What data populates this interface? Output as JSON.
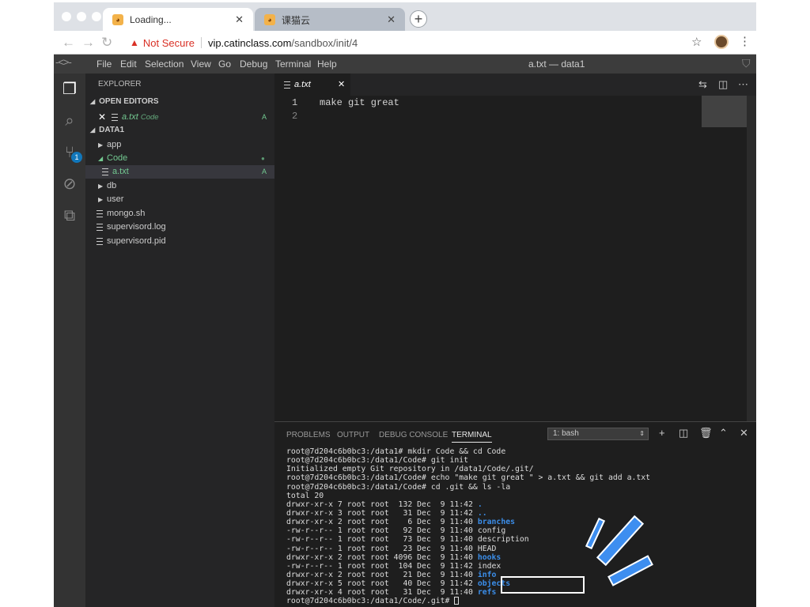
{
  "browser": {
    "tabs": [
      {
        "title": "Loading...",
        "close": "✕"
      },
      {
        "title": "课猫云",
        "close": "✕"
      }
    ],
    "new_tab": "+",
    "security_warning": "Not Secure",
    "url_domain": "vip.catinclass.com",
    "url_path": "/sandbox/init/4"
  },
  "menu": {
    "items": [
      "File",
      "Edit",
      "Selection",
      "View",
      "Go",
      "Debug",
      "Terminal",
      "Help"
    ],
    "window_title": "a.txt — data1"
  },
  "activity_bar": {
    "icons": [
      "explorer-icon",
      "search-icon",
      "source-control-icon",
      "debug-icon",
      "extensions-icon"
    ],
    "scm_badge": "1"
  },
  "sidebar": {
    "title": "EXPLORER",
    "open_editors_label": "OPEN EDITORS",
    "open_editor": {
      "name": "a.txt",
      "folder": "Code",
      "status": "A"
    },
    "workspace_label": "DATA1",
    "tree": [
      {
        "name": "app",
        "kind": "folder"
      },
      {
        "name": "Code",
        "kind": "folder-open"
      },
      {
        "name": "a.txt",
        "kind": "file",
        "status": "A"
      },
      {
        "name": "db",
        "kind": "folder"
      },
      {
        "name": "user",
        "kind": "folder"
      },
      {
        "name": "mongo.sh",
        "kind": "file"
      },
      {
        "name": "supervisord.log",
        "kind": "file"
      },
      {
        "name": "supervisord.pid",
        "kind": "file"
      }
    ]
  },
  "editor": {
    "tab": "a.txt",
    "tab_close": "✕",
    "lines": [
      {
        "num": "1",
        "text": "make git great"
      },
      {
        "num": "2",
        "text": ""
      }
    ]
  },
  "panel": {
    "tabs": [
      "PROBLEMS",
      "OUTPUT",
      "DEBUG CONSOLE",
      "TERMINAL"
    ],
    "active_tab": "TERMINAL",
    "terminal_select": "1: bash",
    "terminal_lines": [
      {
        "text": "root@7d204c6b0bc3:/data1# mkdir Code && cd Code"
      },
      {
        "text": "root@7d204c6b0bc3:/data1/Code# git init"
      },
      {
        "text": "Initialized empty Git repository in /data1/Code/.git/"
      },
      {
        "text": "root@7d204c6b0bc3:/data1/Code# echo \"make git great \" > a.txt && git add a.txt"
      },
      {
        "text": "root@7d204c6b0bc3:/data1/Code# cd .git && ls -la"
      },
      {
        "text": "total 20"
      },
      {
        "text": "drwxr-xr-x 7 root root  132 Dec  9 11:42 ",
        "name": "."
      },
      {
        "text": "drwxr-xr-x 3 root root   31 Dec  9 11:42 ",
        "name": ".."
      },
      {
        "text": "drwxr-xr-x 2 root root    6 Dec  9 11:40 ",
        "name": "branches"
      },
      {
        "text": "-rw-r--r-- 1 root root   92 Dec  9 11:40 config"
      },
      {
        "text": "-rw-r--r-- 1 root root   73 Dec  9 11:40 description"
      },
      {
        "text": "-rw-r--r-- 1 root root   23 Dec  9 11:40 HEAD"
      },
      {
        "text": "drwxr-xr-x 2 root root 4096 Dec  9 11:40 ",
        "name": "hooks"
      },
      {
        "text": "-rw-r--r-- 1 root root  104 Dec  9 11:42 index"
      },
      {
        "text": "drwxr-xr-x 2 root root   21 Dec  9 11:40 ",
        "name": "info"
      },
      {
        "text": "drwxr-xr-x 5 root root   40 Dec  9 11:42 ",
        "name": "objects"
      },
      {
        "text": "drwxr-xr-x 4 root root   31 Dec  9 11:40 ",
        "name": "refs"
      },
      {
        "text": "root@7d204c6b0bc3:/data1/Code/.git# ",
        "cursor": true
      }
    ]
  },
  "colors": {
    "accent_blue": "#3d8ef0",
    "git_added": "#73c991",
    "dir_blue": "#3b8eea"
  }
}
